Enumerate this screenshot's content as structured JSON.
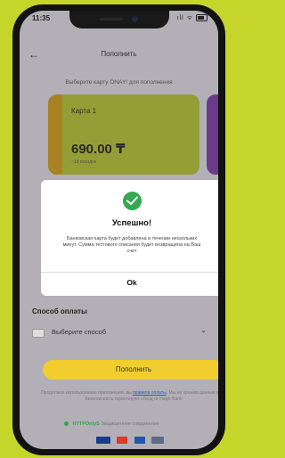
{
  "status_bar": {
    "time": "11:35",
    "signal": "ıll ᯤ"
  },
  "nav": {
    "title": "Пополнить",
    "back_icon": "arrow-left-icon"
  },
  "choose_card_label": "Выберите карту ONAY! для пополнения",
  "card": {
    "name": "Карта 1",
    "balance": "690.00 ₸",
    "subtitle": "~18 поездок",
    "accent": "#c7d63d"
  },
  "modal": {
    "icon": "check-circle-icon",
    "title": "Успешно!",
    "message": "Банковская карта будет добавлена в течении нескольких минут. Сумма тестового списания будет возвращена на Ваш счет",
    "ok_label": "Ok",
    "success_color": "#34a853"
  },
  "payment": {
    "label": "Способ оплаты",
    "placeholder": "Выберите способ"
  },
  "topup_button": {
    "label": "Пополнить",
    "color": "#f1cd2e"
  },
  "legal": {
    "text_before": "Продолжая использование приложения, вы",
    "link_text": "правила оплаты",
    "text_after": ". Мы не храним данные карт. Безопасность гарантирует обход от Halyk Bank"
  },
  "secure": {
    "brand": "HTTPOnlyS",
    "text": "Защищенное соединение"
  },
  "payment_logos": [
    "visa",
    "mastercard",
    "visa",
    "other"
  ]
}
